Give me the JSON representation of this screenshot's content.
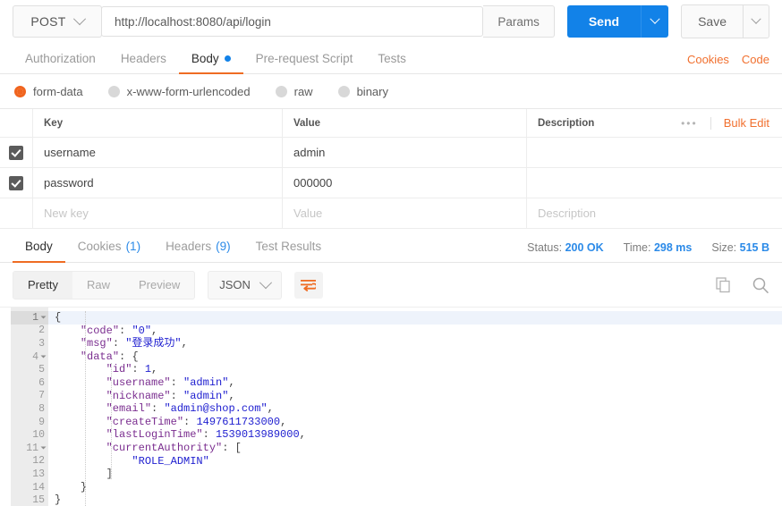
{
  "request": {
    "method": "POST",
    "url": "http://localhost:8080/api/login",
    "params_label": "Params",
    "send_label": "Send",
    "save_label": "Save",
    "tabs": [
      {
        "label": "Authorization",
        "active": false,
        "dot": false
      },
      {
        "label": "Headers",
        "active": false,
        "dot": false
      },
      {
        "label": "Body",
        "active": true,
        "dot": true
      },
      {
        "label": "Pre-request Script",
        "active": false,
        "dot": false
      },
      {
        "label": "Tests",
        "active": false,
        "dot": false
      }
    ],
    "cookies_link": "Cookies",
    "code_link": "Code",
    "body_types": [
      {
        "label": "form-data",
        "selected": true
      },
      {
        "label": "x-www-form-urlencoded",
        "selected": false
      },
      {
        "label": "raw",
        "selected": false
      },
      {
        "label": "binary",
        "selected": false
      }
    ],
    "table": {
      "headers": {
        "key": "Key",
        "value": "Value",
        "description": "Description"
      },
      "bulk_edit_label": "Bulk Edit",
      "rows": [
        {
          "checked": true,
          "key": "username",
          "value": "admin",
          "description": ""
        },
        {
          "checked": true,
          "key": "password",
          "value": "000000",
          "description": ""
        }
      ],
      "new_row": {
        "key_placeholder": "New key",
        "value_placeholder": "Value",
        "description_placeholder": "Description"
      }
    }
  },
  "response": {
    "tabs": [
      {
        "label": "Body",
        "count": "",
        "active": true
      },
      {
        "label": "Cookies",
        "count": "(1)",
        "active": false
      },
      {
        "label": "Headers",
        "count": "(9)",
        "active": false
      },
      {
        "label": "Test Results",
        "count": "",
        "active": false
      }
    ],
    "meta": {
      "status_label": "Status:",
      "status_value": "200 OK",
      "time_label": "Time:",
      "time_value": "298 ms",
      "size_label": "Size:",
      "size_value": "515 B"
    },
    "view_modes": [
      {
        "label": "Pretty",
        "active": true
      },
      {
        "label": "Raw",
        "active": false
      },
      {
        "label": "Preview",
        "active": false
      }
    ],
    "format": "JSON",
    "body_lines": [
      {
        "n": "1",
        "fold": true,
        "text": "{"
      },
      {
        "n": "2",
        "fold": false,
        "text": "    \"code\": \"0\","
      },
      {
        "n": "3",
        "fold": false,
        "text": "    \"msg\": \"登录成功\","
      },
      {
        "n": "4",
        "fold": true,
        "text": "    \"data\": {"
      },
      {
        "n": "5",
        "fold": false,
        "text": "        \"id\": 1,"
      },
      {
        "n": "6",
        "fold": false,
        "text": "        \"username\": \"admin\","
      },
      {
        "n": "7",
        "fold": false,
        "text": "        \"nickname\": \"admin\","
      },
      {
        "n": "8",
        "fold": false,
        "text": "        \"email\": \"admin@shop.com\","
      },
      {
        "n": "9",
        "fold": false,
        "text": "        \"createTime\": 1497611733000,"
      },
      {
        "n": "10",
        "fold": false,
        "text": "        \"lastLoginTime\": 1539013989000,"
      },
      {
        "n": "11",
        "fold": true,
        "text": "        \"currentAuthority\": ["
      },
      {
        "n": "12",
        "fold": false,
        "text": "            \"ROLE_ADMIN\""
      },
      {
        "n": "13",
        "fold": false,
        "text": "        ]"
      },
      {
        "n": "14",
        "fold": false,
        "text": "    }"
      },
      {
        "n": "15",
        "fold": false,
        "text": "}"
      }
    ]
  },
  "colors": {
    "accent_orange": "#ef6c23",
    "accent_blue": "#1282e8",
    "json_key": "#7a2d8f",
    "json_string": "#2020d0"
  }
}
